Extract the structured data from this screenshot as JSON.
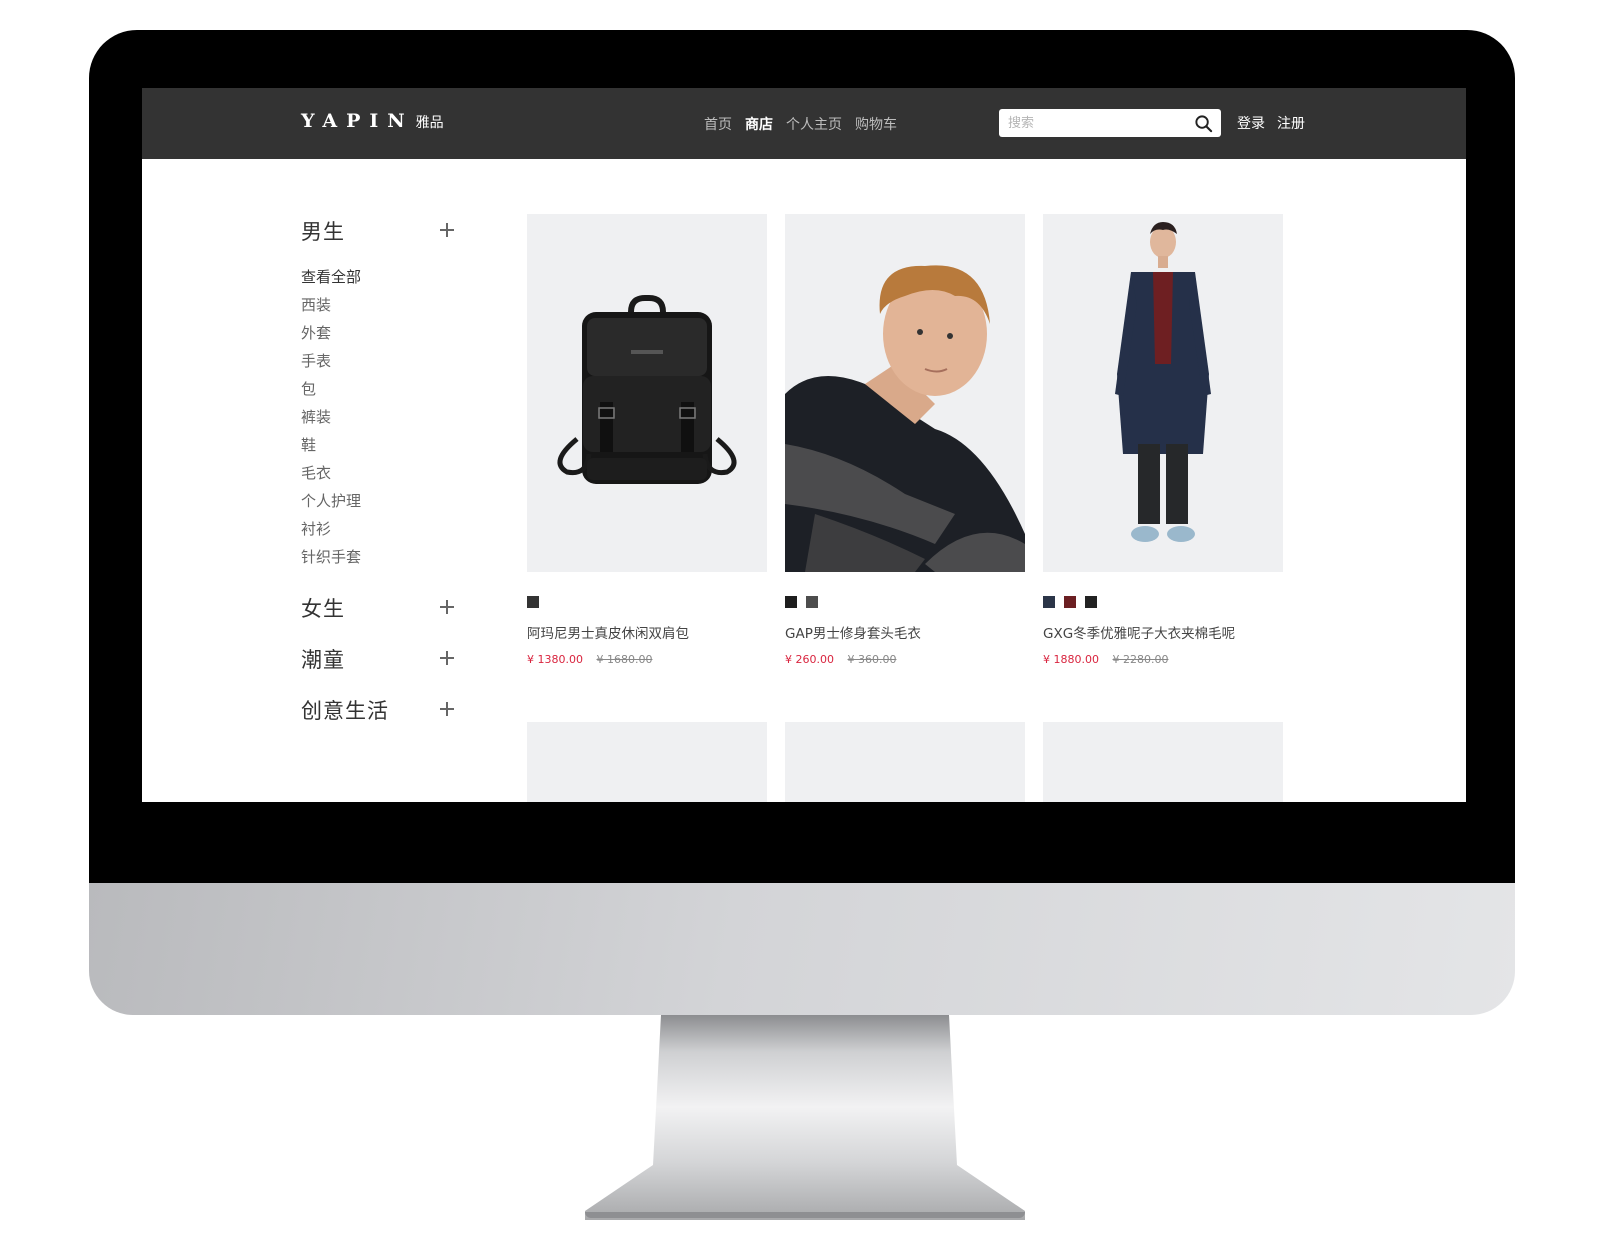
{
  "site": {
    "logo_text": "YAPIN",
    "logo_cn": "雅品"
  },
  "nav": {
    "items": [
      {
        "label": "首页"
      },
      {
        "label": "商店"
      },
      {
        "label": "个人主页"
      },
      {
        "label": "购物车"
      }
    ],
    "active_index": 1
  },
  "search": {
    "placeholder": "搜索",
    "value": ""
  },
  "auth": {
    "login": "登录",
    "register": "注册"
  },
  "sidebar": {
    "categories": [
      {
        "title": "男生",
        "expanded": true,
        "items": [
          "查看全部",
          "西装",
          "外套",
          "手表",
          "包",
          "裤装",
          "鞋",
          "毛衣",
          "个人护理",
          "衬衫",
          "针织手套"
        ]
      },
      {
        "title": "女生",
        "expanded": false
      },
      {
        "title": "潮童",
        "expanded": false
      },
      {
        "title": "创意生活",
        "expanded": false
      }
    ]
  },
  "products": [
    {
      "name": "阿玛尼男士真皮休闲双肩包",
      "price": "¥ 1380.00",
      "original_price": "¥ 1680.00",
      "image": "backpack",
      "colors": [
        "#333333"
      ]
    },
    {
      "name": "GAP男士修身套头毛衣",
      "price": "¥ 260.00",
      "original_price": "¥ 360.00",
      "image": "model-sweater",
      "colors": [
        "#1e1e1e",
        "#4d4d4d"
      ]
    },
    {
      "name": "GXG冬季优雅呢子大衣夹棉毛呢",
      "price": "¥ 1880.00",
      "original_price": "¥ 2280.00",
      "image": "model-coat",
      "colors": [
        "#2b3548",
        "#6b1f22",
        "#222222"
      ]
    }
  ],
  "colors": {
    "topbar": "#333333",
    "price_accent": "#d9253f",
    "card_bg": "#eff0f2"
  }
}
